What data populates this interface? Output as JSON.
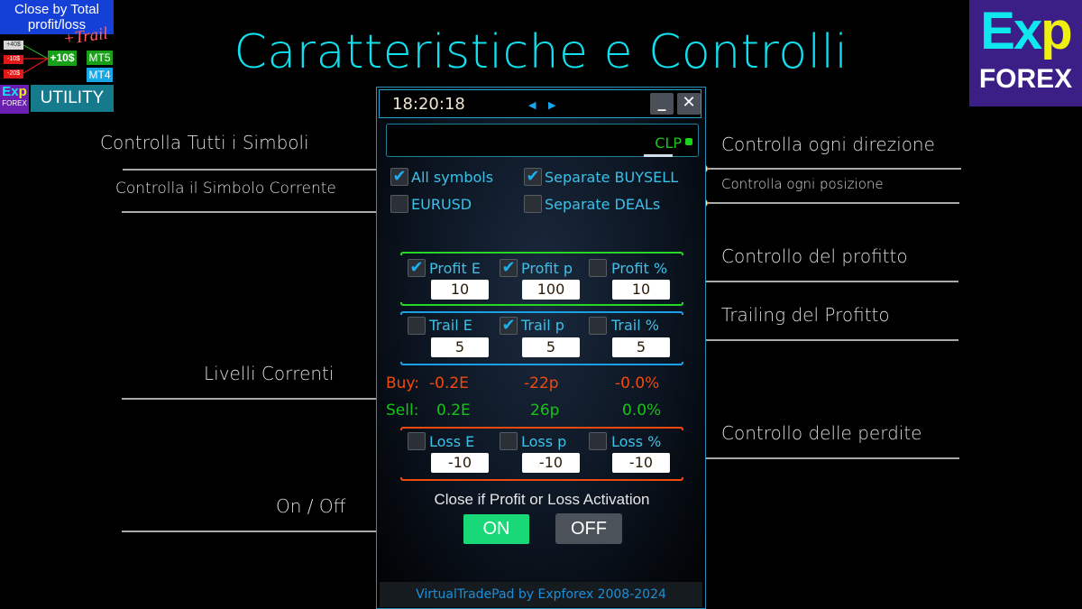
{
  "page_title": "Caratteristiche e Controlli",
  "logo_left": {
    "header": "Close by Total profit/loss",
    "trail": "+Trail",
    "chips": [
      "+40$",
      "-10$",
      "-20$"
    ],
    "result": "+10$",
    "platforms": [
      "MT5",
      "MT4"
    ],
    "brand_top": "Exp",
    "brand_bottom": "FOREX",
    "utility": "UTILITY"
  },
  "logo_right": {
    "brand_top_a": "Ex",
    "brand_top_b": "p",
    "brand_bottom": "FOREX"
  },
  "annotations": {
    "all_symbols": "Controlla Tutti i Simboli",
    "current_symbol": "Controlla il Simbolo Corrente",
    "each_direction": "Controlla ogni direzione",
    "each_position": "Controlla ogni posizione",
    "profit_control": "Controllo del profitto",
    "profit_trailing": "Trailing del Profitto",
    "current_levels": "Livelli Correnti",
    "loss_control": "Controllo delle perdite",
    "on_off": "On / Off"
  },
  "panel": {
    "clock": "18:20:18",
    "minimize": "_",
    "close": "✕",
    "clp_label": "CLP",
    "options": [
      {
        "label": "All symbols",
        "checked": true
      },
      {
        "label": "Separate BUYSELL",
        "checked": true
      },
      {
        "label": "EURUSD",
        "checked": false
      },
      {
        "label": "Separate DEALs",
        "checked": false
      }
    ],
    "profit": [
      {
        "label": "Profit E",
        "checked": true,
        "value": "10"
      },
      {
        "label": "Profit p",
        "checked": true,
        "value": "100"
      },
      {
        "label": "Profit %",
        "checked": false,
        "value": "10"
      }
    ],
    "trail": [
      {
        "label": "Trail E",
        "checked": false,
        "value": "5"
      },
      {
        "label": "Trail p",
        "checked": true,
        "value": "5"
      },
      {
        "label": "Trail %",
        "checked": false,
        "value": "5"
      }
    ],
    "levels": {
      "buy": {
        "label": "Buy:",
        "equity": "-0.2E",
        "points": "-22p",
        "percent": "-0.0%"
      },
      "sell": {
        "label": "Sell:",
        "equity": "0.2E",
        "points": "26p",
        "percent": "0.0%"
      }
    },
    "loss": [
      {
        "label": "Loss E",
        "checked": false,
        "value": "-10"
      },
      {
        "label": "Loss p",
        "checked": false,
        "value": "-10"
      },
      {
        "label": "Loss %",
        "checked": false,
        "value": "-10"
      }
    ],
    "activation_title": "Close if Profit or Loss Activation",
    "on_label": "ON",
    "off_label": "OFF",
    "footer": "VirtualTradePad by Expforex 2008-2024"
  },
  "colors": {
    "title": "#10e0ee",
    "profit_group": "#22d822",
    "trail_group": "#1aa0e8",
    "loss_group": "#f04a10",
    "buy": "#f04a10",
    "sell": "#18c418",
    "on_button": "#18d878"
  }
}
